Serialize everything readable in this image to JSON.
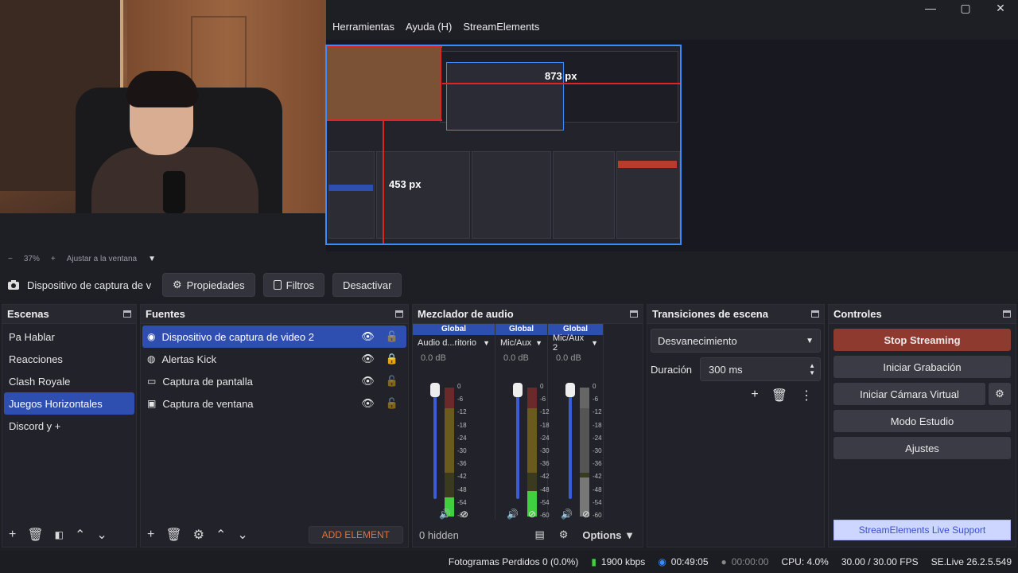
{
  "menu": [
    "Herramientas",
    "Ayuda (H)",
    "StreamElements"
  ],
  "window_controls": [
    "—",
    "▢",
    "✕"
  ],
  "preview": {
    "label_width": "873 px",
    "label_height": "453 px"
  },
  "zoom": {
    "minus": "−",
    "value": "37%",
    "plus": "+",
    "fit": "Ajustar a la ventana",
    "dropdown": "▼"
  },
  "source_toolbar": {
    "source_name": "Dispositivo de captura de v",
    "properties": "Propiedades",
    "filters": "Filtros",
    "deactivate": "Desactivar"
  },
  "scenes": {
    "title": "Escenas",
    "items": [
      "Pa Hablar",
      "Reacciones",
      "Clash Royale",
      "Juegos Horizontales",
      "Discord y +"
    ],
    "selected_index": 3
  },
  "sources": {
    "title": "Fuentes",
    "items": [
      {
        "name": "Dispositivo de captura de video 2",
        "icon": "camera-icon",
        "locked": false,
        "selected": true
      },
      {
        "name": "Alertas Kick",
        "icon": "globe-icon",
        "locked": true,
        "selected": false
      },
      {
        "name": "Captura de pantalla",
        "icon": "monitor-icon",
        "locked": false,
        "selected": false
      },
      {
        "name": "Captura de ventana",
        "icon": "window-icon",
        "locked": false,
        "selected": false
      }
    ],
    "add_element": "ADD ELEMENT"
  },
  "mixer": {
    "title": "Mezclador de audio",
    "channels": [
      {
        "header": "Global",
        "name": "Audio d...ritorio",
        "db": "0.0 dB",
        "muted": false,
        "level": 0.15
      },
      {
        "header": "Global",
        "name": "Mic/Aux",
        "db": "0.0 dB",
        "muted": false,
        "level": 0.2
      },
      {
        "header": "Global",
        "name": "Mic/Aux 2",
        "db": "0.0 dB",
        "muted": true,
        "level": 0.3
      }
    ],
    "scale": [
      "0",
      "-6",
      "-12",
      "-18",
      "-24",
      "-30",
      "-36",
      "-42",
      "-48",
      "-54",
      "-60"
    ],
    "hidden": "0 hidden",
    "options": "Options"
  },
  "transitions": {
    "title": "Transiciones de escena",
    "selected": "Desvanecimiento",
    "duration_label": "Duración",
    "duration_value": "300 ms"
  },
  "controls": {
    "title": "Controles",
    "stop_streaming": "Stop Streaming",
    "start_recording": "Iniciar Grabación",
    "virtual_camera": "Iniciar Cámara Virtual",
    "studio_mode": "Modo Estudio",
    "settings": "Ajustes",
    "support": "StreamElements Live Support"
  },
  "status": {
    "dropped_frames": "Fotogramas Perdidos 0 (0.0%)",
    "bitrate": "1900 kbps",
    "stream_time": "00:49:05",
    "rec_time": "00:00:00",
    "cpu": "CPU: 4.0%",
    "fps": "30.00 / 30.00 FPS",
    "version": "SE.Live 26.2.5.549"
  },
  "colors": {
    "accent": "#2f4fb0",
    "stop_streaming": "#8e3a2e",
    "meter_green": "#3fcf3f",
    "meter_yellow": "#c8a82a",
    "meter_red": "#c83a3a",
    "add_element": "#e0733a"
  }
}
